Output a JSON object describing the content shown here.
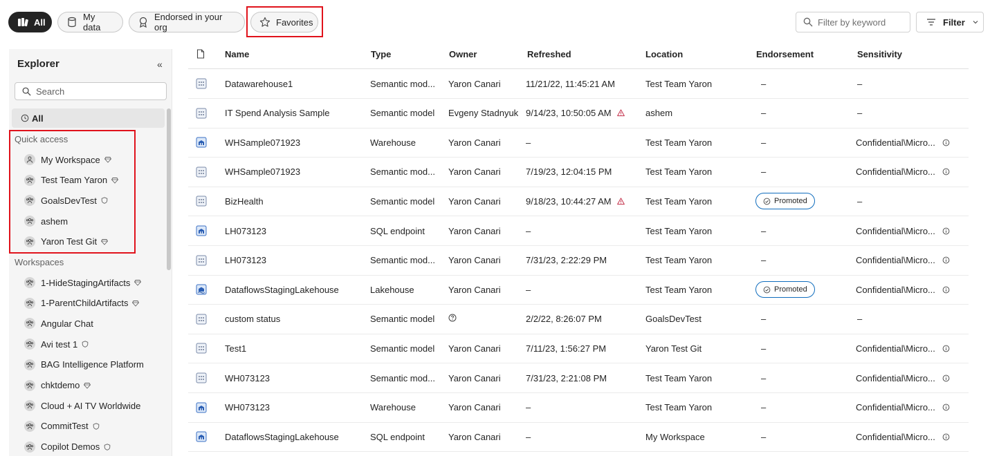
{
  "filters": {
    "pills": [
      {
        "label": "All",
        "icon": "catalog-icon",
        "active": true
      },
      {
        "label": "My data",
        "icon": "database-icon"
      },
      {
        "label": "Endorsed in your org",
        "icon": "ribbon-icon"
      },
      {
        "label": "Favorites",
        "icon": "star-icon"
      }
    ],
    "keyword_placeholder": "Filter by keyword",
    "filter_label": "Filter"
  },
  "explorer": {
    "title": "Explorer",
    "collapse_glyph": "«",
    "search_placeholder": "Search",
    "all_label": "All",
    "quick_access_label": "Quick access",
    "quick_access": [
      {
        "label": "My Workspace",
        "icon": "person-icon",
        "badge": "diamond"
      },
      {
        "label": "Test Team Yaron",
        "icon": "group-icon",
        "badge": "diamond"
      },
      {
        "label": "GoalsDevTest",
        "icon": "group-icon",
        "badge": "shield"
      },
      {
        "label": "ashem",
        "icon": "group-icon",
        "badge": ""
      },
      {
        "label": "Yaron Test Git",
        "icon": "group-icon",
        "badge": "diamond"
      }
    ],
    "workspaces_label": "Workspaces",
    "workspaces": [
      {
        "label": "1-HideStagingArtifacts",
        "badge": "diamond"
      },
      {
        "label": "1-ParentChildArtifacts",
        "badge": "diamond"
      },
      {
        "label": "Angular Chat",
        "badge": ""
      },
      {
        "label": "Avi test 1",
        "badge": "shield"
      },
      {
        "label": "BAG Intelligence Platform",
        "badge": ""
      },
      {
        "label": "chktdemo",
        "badge": "diamond"
      },
      {
        "label": "Cloud + AI TV Worldwide",
        "badge": ""
      },
      {
        "label": "CommitTest",
        "badge": "shield"
      },
      {
        "label": "Copilot Demos",
        "badge": "shield"
      }
    ]
  },
  "table": {
    "columns": [
      "Name",
      "Type",
      "Owner",
      "Refreshed",
      "Location",
      "Endorsement",
      "Sensitivity"
    ],
    "rows": [
      {
        "icon": "semantic-model",
        "name": "Datawarehouse1",
        "type": "Semantic mod...",
        "owner": "Yaron Canari",
        "refreshed": "11/21/22, 11:45:21 AM",
        "warn": false,
        "location": "Test Team Yaron",
        "endorsement": "–",
        "sensitivity": "–",
        "info": false
      },
      {
        "icon": "semantic-model",
        "name": "IT Spend Analysis Sample",
        "type": "Semantic model",
        "owner": "Evgeny Stadnyuk",
        "refreshed": "9/14/23, 10:50:05 AM",
        "warn": true,
        "location": "ashem",
        "endorsement": "–",
        "sensitivity": "–",
        "info": false
      },
      {
        "icon": "warehouse",
        "name": "WHSample071923",
        "type": "Warehouse",
        "owner": "Yaron Canari",
        "refreshed": "–",
        "warn": false,
        "location": "Test Team Yaron",
        "endorsement": "–",
        "sensitivity": "Confidential\\Micro...",
        "info": true
      },
      {
        "icon": "semantic-model",
        "name": "WHSample071923",
        "type": "Semantic mod...",
        "owner": "Yaron Canari",
        "refreshed": "7/19/23, 12:04:15 PM",
        "warn": false,
        "location": "Test Team Yaron",
        "endorsement": "–",
        "sensitivity": "Confidential\\Micro...",
        "info": true
      },
      {
        "icon": "semantic-model",
        "name": "BizHealth",
        "type": "Semantic model",
        "owner": "Yaron Canari",
        "refreshed": "9/18/23, 10:44:27 AM",
        "warn": true,
        "location": "Test Team Yaron",
        "endorsement": "Promoted",
        "sensitivity": "–",
        "info": false
      },
      {
        "icon": "warehouse",
        "name": "LH073123",
        "type": "SQL endpoint",
        "owner": "Yaron Canari",
        "refreshed": "–",
        "warn": false,
        "location": "Test Team Yaron",
        "endorsement": "–",
        "sensitivity": "Confidential\\Micro...",
        "info": true
      },
      {
        "icon": "semantic-model",
        "name": "LH073123",
        "type": "Semantic mod...",
        "owner": "Yaron Canari",
        "refreshed": "7/31/23, 2:22:29 PM",
        "warn": false,
        "location": "Test Team Yaron",
        "endorsement": "–",
        "sensitivity": "Confidential\\Micro...",
        "info": true
      },
      {
        "icon": "lakehouse",
        "name": "DataflowsStagingLakehouse",
        "type": "Lakehouse",
        "owner": "Yaron Canari",
        "refreshed": "–",
        "warn": false,
        "location": "Test Team Yaron",
        "endorsement": "Promoted",
        "sensitivity": "Confidential\\Micro...",
        "info": true
      },
      {
        "icon": "semantic-model",
        "name": "custom status",
        "type": "Semantic model",
        "owner": "?",
        "refreshed": "2/2/22, 8:26:07 PM",
        "warn": false,
        "location": "GoalsDevTest",
        "endorsement": "–",
        "sensitivity": "–",
        "info": false
      },
      {
        "icon": "semantic-model",
        "name": "Test1",
        "type": "Semantic model",
        "owner": "Yaron Canari",
        "refreshed": "7/11/23, 1:56:27 PM",
        "warn": false,
        "location": "Yaron Test Git",
        "endorsement": "–",
        "sensitivity": "Confidential\\Micro...",
        "info": true
      },
      {
        "icon": "semantic-model",
        "name": "WH073123",
        "type": "Semantic mod...",
        "owner": "Yaron Canari",
        "refreshed": "7/31/23, 2:21:08 PM",
        "warn": false,
        "location": "Test Team Yaron",
        "endorsement": "–",
        "sensitivity": "Confidential\\Micro...",
        "info": true
      },
      {
        "icon": "warehouse",
        "name": "WH073123",
        "type": "Warehouse",
        "owner": "Yaron Canari",
        "refreshed": "–",
        "warn": false,
        "location": "Test Team Yaron",
        "endorsement": "–",
        "sensitivity": "Confidential\\Micro...",
        "info": true
      },
      {
        "icon": "warehouse",
        "name": "DataflowsStagingLakehouse",
        "type": "SQL endpoint",
        "owner": "Yaron Canari",
        "refreshed": "–",
        "warn": false,
        "location": "My Workspace",
        "endorsement": "–",
        "sensitivity": "Confidential\\Micro...",
        "info": true
      }
    ]
  },
  "colors": {
    "accent": "#0f6cbd",
    "highlight": "#e0121b",
    "warning": "#c4314b"
  }
}
